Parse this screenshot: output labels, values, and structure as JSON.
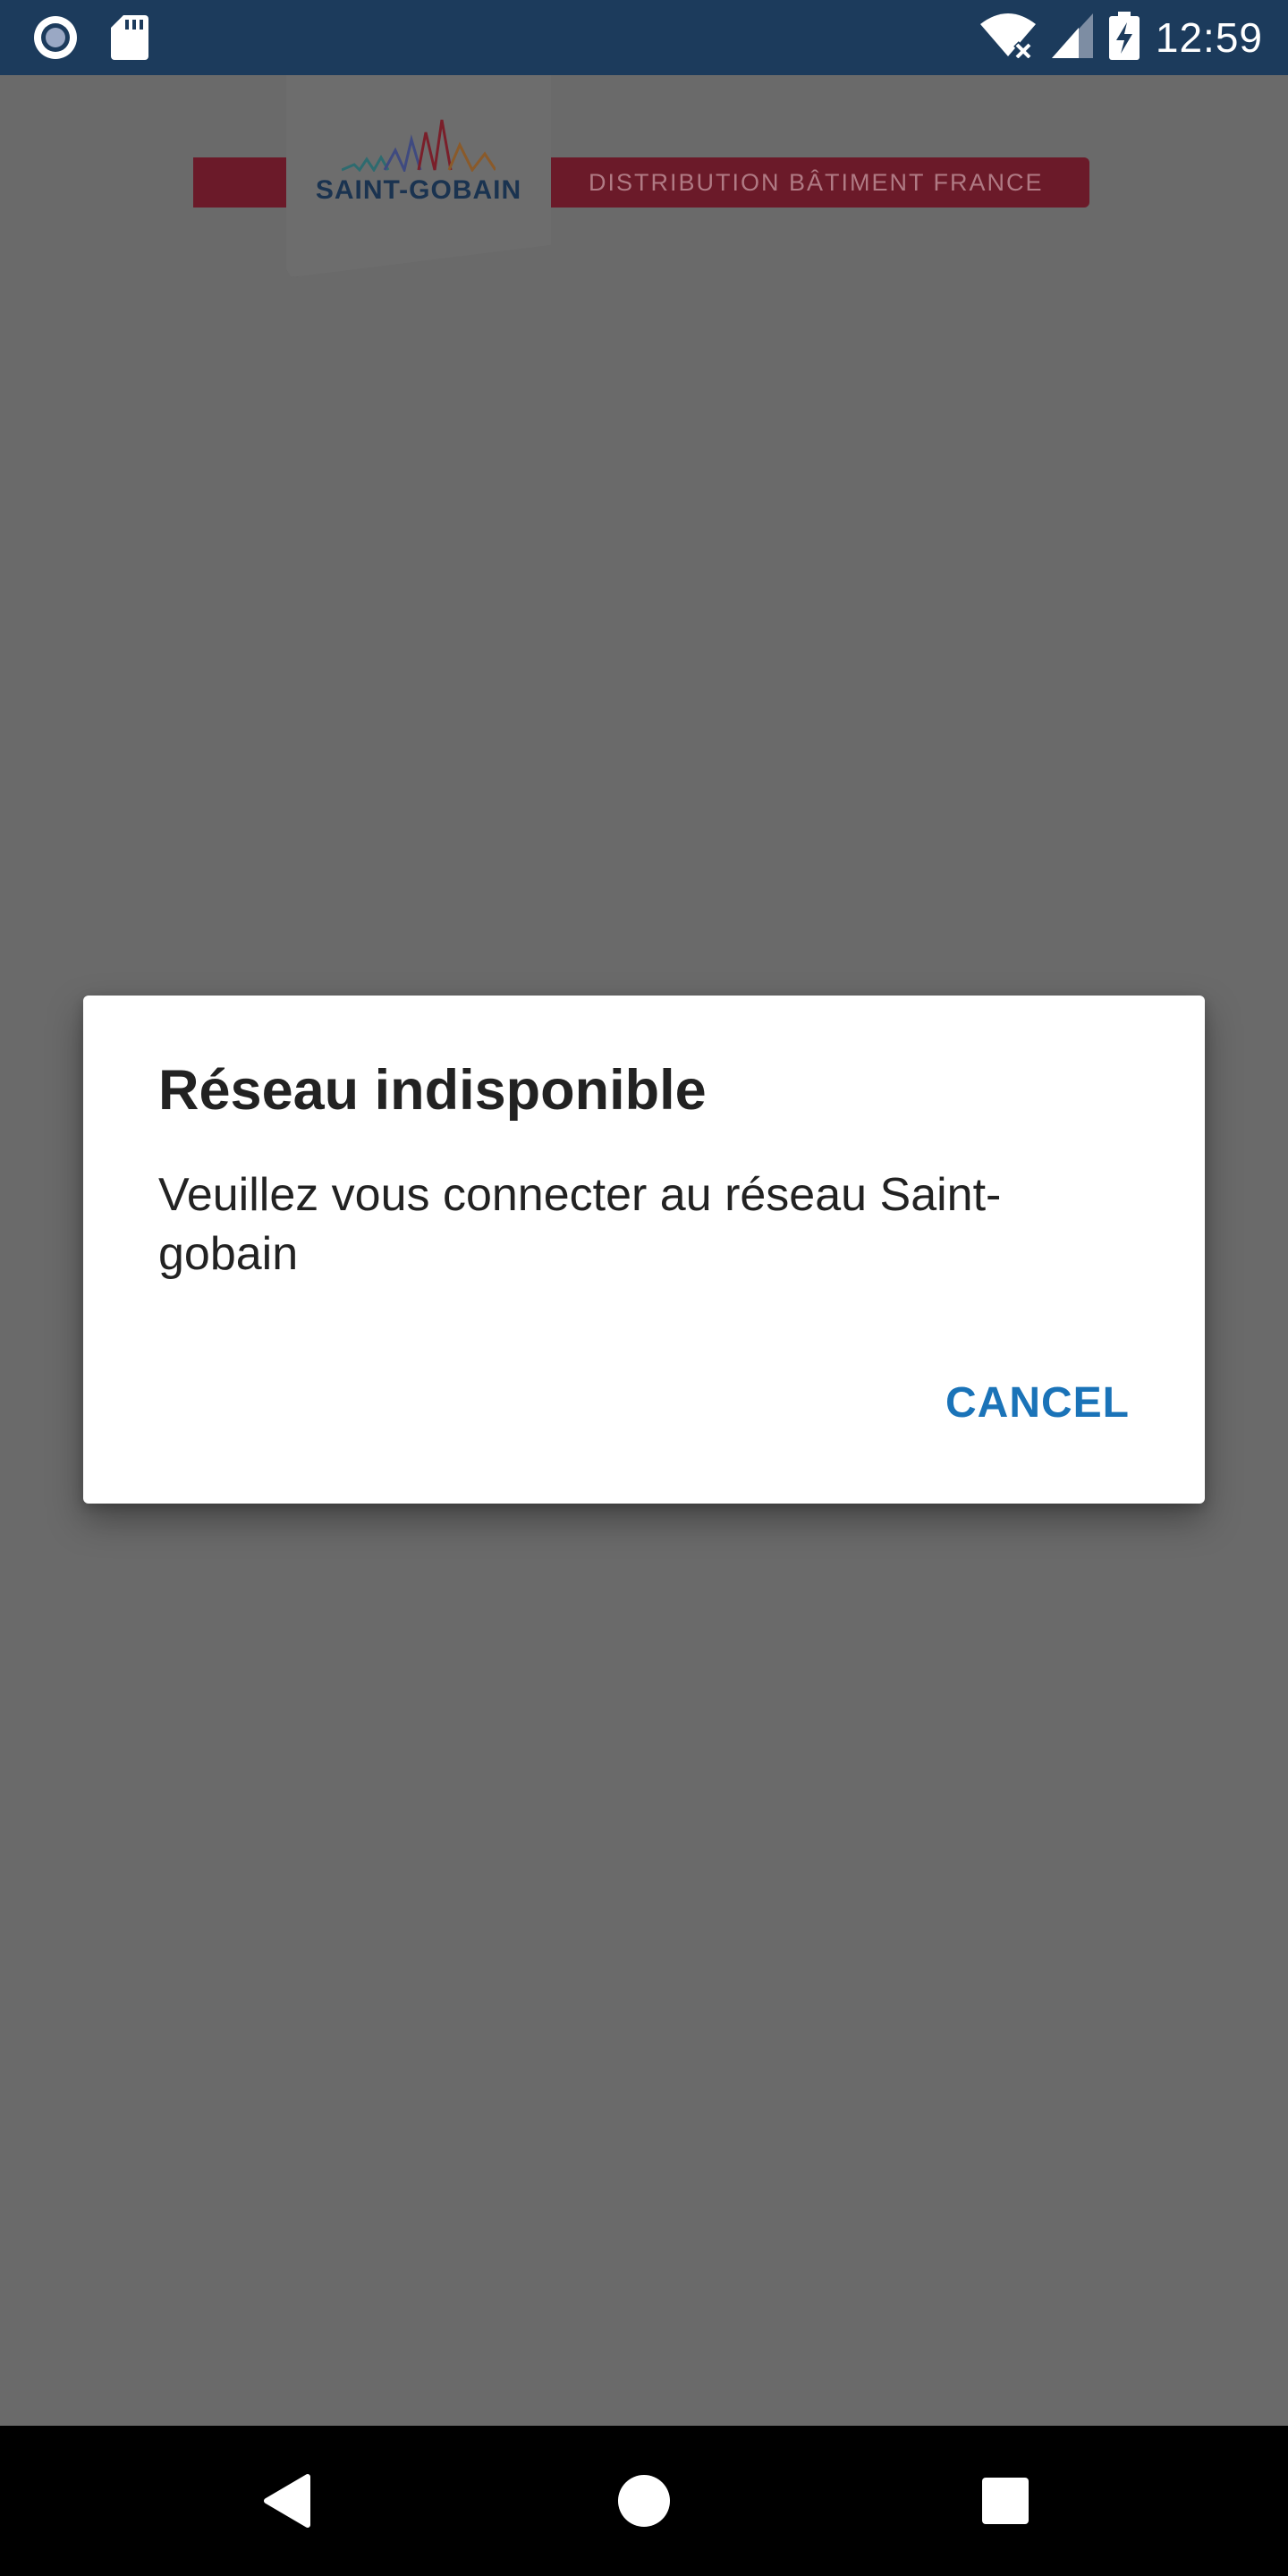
{
  "status_bar": {
    "time": "12:59",
    "icons": [
      "record-icon",
      "sd-card-icon",
      "wifi-off-icon",
      "cell-signal-icon",
      "battery-charging-icon"
    ]
  },
  "header": {
    "logo_text": "SAINT-GOBAIN",
    "banner_text": "DISTRIBUTION BÂTIMENT FRANCE",
    "brand_color": "#c8102e"
  },
  "dialog": {
    "title": "Réseau indisponible",
    "message": "Veuillez vous connecter au réseau Saint-gobain",
    "cancel_label": "CANCEL",
    "accent_color": "#1a73b8"
  },
  "nav_bar": {
    "icons": [
      "back-icon",
      "home-icon",
      "recents-icon"
    ]
  }
}
